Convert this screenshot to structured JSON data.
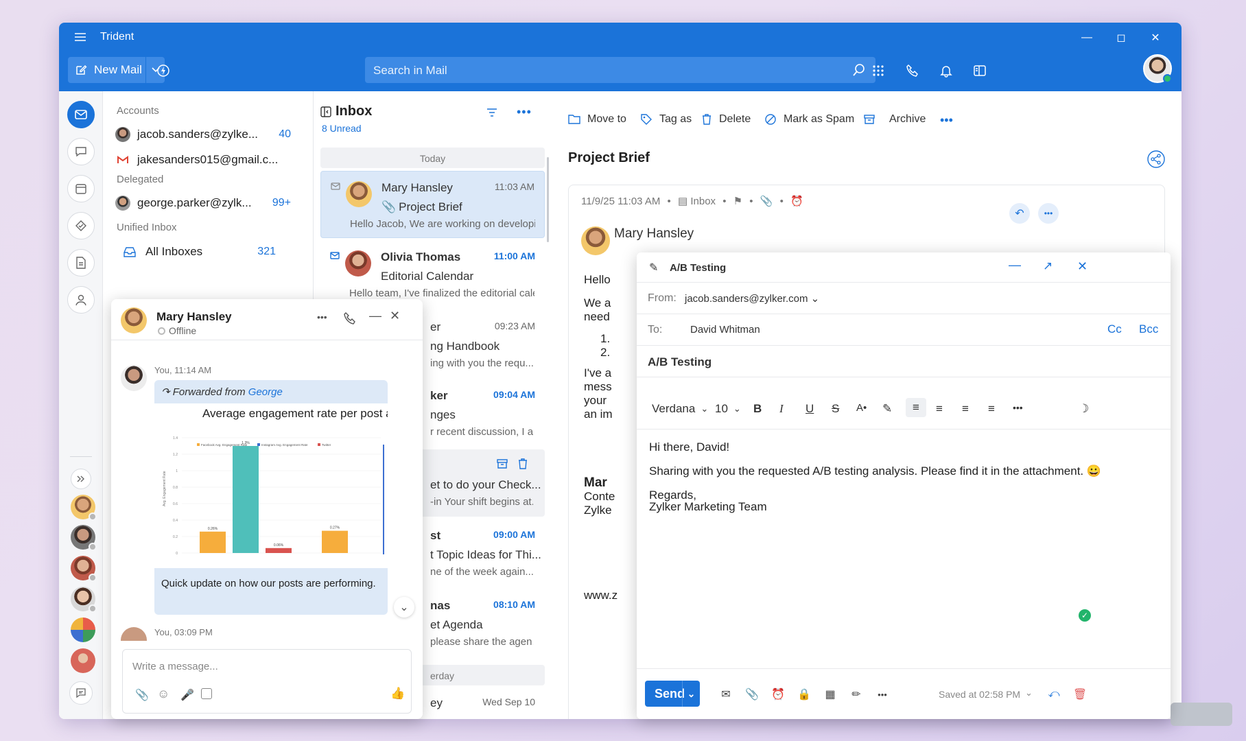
{
  "app": {
    "title": "Trident"
  },
  "toolbar": {
    "new_mail": "New Mail",
    "search_placeholder": "Search in Mail"
  },
  "folders": {
    "accounts_label": "Accounts",
    "accounts": [
      {
        "email": "jacob.sanders@zylke...",
        "count": "40"
      },
      {
        "email": "jakesanders015@gmail.c...",
        "count": ""
      }
    ],
    "delegated_label": "Delegated",
    "delegated": [
      {
        "email": "george.parker@zylk...",
        "count": "99+"
      }
    ],
    "unified_label": "Unified Inbox",
    "unified": [
      {
        "label": "All Inboxes",
        "count": "321"
      }
    ]
  },
  "inbox": {
    "title": "Inbox",
    "unread": "8 Unread",
    "today": "Today",
    "yesterday": "erday",
    "messages": [
      {
        "sender": "Mary Hansley",
        "time": "11:03 AM",
        "subject": "Project Brief",
        "preview": "Hello Jacob, We are working on developin..."
      },
      {
        "sender": "Olivia Thomas",
        "time": "11:00 AM",
        "subject": "Editorial Calendar",
        "preview": "Hello team, I've finalized the editorial cale..."
      },
      {
        "sender": "er",
        "time": "09:23 AM",
        "subject": "ng Handbook",
        "preview": "ing with you the requ..."
      },
      {
        "sender": "ker",
        "time": "09:04 AM",
        "subject": "nges",
        "preview": "r recent discussion, I a..."
      },
      {
        "sender": "",
        "time": "",
        "subject": "et to do your Check...",
        "preview": "-in Your shift begins at..."
      },
      {
        "sender": "st",
        "time": "09:00 AM",
        "subject": "t Topic Ideas for Thi...",
        "preview": "ne of the week again..."
      },
      {
        "sender": "nas",
        "time": "08:10 AM",
        "subject": "et Agenda",
        "preview": "please share the agen..."
      },
      {
        "sender": "ey",
        "time": "Wed Sep 10",
        "subject": "",
        "preview": ""
      }
    ]
  },
  "reading": {
    "actions": [
      "Move to",
      "Tag as",
      "Delete",
      "Mark as Spam",
      "Archive"
    ],
    "subject": "Project Brief",
    "meta_date": "11/9/25 11:03 AM",
    "meta_folder": "Inbox",
    "from_name": "Mary Hansley",
    "body_bits": [
      "Hello",
      "We a",
      "need",
      "1.",
      "2.",
      "I've a",
      "mess",
      "your",
      "an im",
      "Mar",
      "Conte",
      "Zylke",
      "www.z"
    ]
  },
  "chat": {
    "name": "Mary Hansley",
    "status": "Offline",
    "msg1_time": "You, 11:14 AM",
    "forwarded_prefix": "Forwarded from",
    "forwarded_from": "George",
    "message": "Quick update on how our posts are performing.",
    "msg2_time": "You, 03:09 PM",
    "input_placeholder": "Write a message..."
  },
  "chart_data": {
    "type": "bar",
    "title": "Average engagement rate per post across all industries (by follow",
    "legend": [
      "Facebook Avg. Engagement Rate",
      "Instagram Avg. Engagement Rate",
      "Twitter"
    ],
    "ylabel": "Avg. Engagement Rate",
    "yticks": [
      "0",
      "0.2",
      "0.4",
      "0.6",
      "0.8",
      "1",
      "1.2",
      "1.4"
    ],
    "bars": [
      {
        "series": "Facebook",
        "value": 0.26,
        "label": "0.26%",
        "color": "#f6ad3c"
      },
      {
        "series": "Instagram",
        "value": 1.3,
        "label": "1.3%",
        "color": "#4fbfba"
      },
      {
        "series": "Twitter",
        "value": 0.06,
        "label": "0.06%",
        "color": "#d9534f"
      },
      {
        "series": "Facebook",
        "value": 0.27,
        "label": "0.27%",
        "color": "#f6ad3c"
      }
    ],
    "ylim": [
      0,
      1.4
    ]
  },
  "compose": {
    "title": "A/B Testing",
    "from_label": "From:",
    "from": "jacob.sanders@zylker.com",
    "to_label": "To:",
    "to": "David Whitman",
    "cc": "Cc",
    "bcc": "Bcc",
    "subject": "A/B Testing",
    "font": "Verdana",
    "size": "10",
    "body": [
      "Hi there, David!",
      "Sharing with you the requested A/B testing analysis. Please find it in the attachment. 😀",
      "Regards,",
      "Zylker Marketing Team"
    ],
    "send": "Send",
    "saved": "Saved at 02:58 PM"
  },
  "colors": {
    "brand": "#1b73d9",
    "unread": "#1b73d9"
  }
}
